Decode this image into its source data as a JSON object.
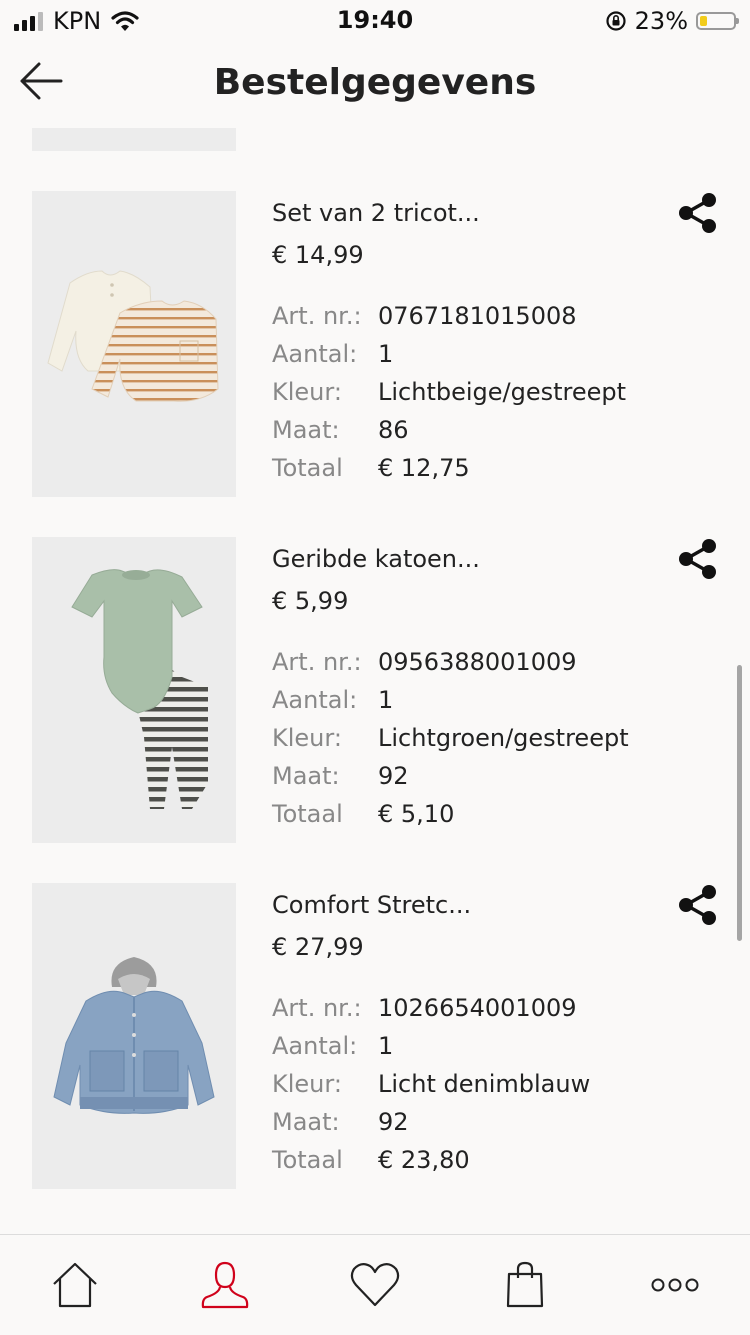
{
  "status_bar": {
    "carrier": "KPN",
    "time": "19:40",
    "battery_percent": "23%",
    "battery_level": 0.23
  },
  "header": {
    "title": "Bestelgegevens"
  },
  "labels": {
    "art_nr": "Art. nr.:",
    "aantal": "Aantal:",
    "kleur": "Kleur:",
    "maat": "Maat:",
    "totaal": "Totaal"
  },
  "items": [
    {
      "name": "Set van 2 tricot...",
      "price": "€ 14,99",
      "art_nr": "0767181015008",
      "aantal": "1",
      "kleur": "Lichtbeige/gestreept",
      "maat": "86",
      "totaal": "€ 12,75"
    },
    {
      "name": "Geribde katoen...",
      "price": "€ 5,99",
      "art_nr": "0956388001009",
      "aantal": "1",
      "kleur": "Lichtgroen/gestreept",
      "maat": "92",
      "totaal": "€ 5,10"
    },
    {
      "name": "Comfort Stretc...",
      "price": "€ 27,99",
      "art_nr": "1026654001009",
      "aantal": "1",
      "kleur": "Licht denimblauw",
      "maat": "92",
      "totaal": "€ 23,80"
    }
  ],
  "tab_bar": {
    "tabs": [
      "home-icon",
      "account-icon",
      "heart-icon",
      "shopping-bag-icon",
      "more-icon"
    ],
    "active_color": "#d0021b"
  }
}
